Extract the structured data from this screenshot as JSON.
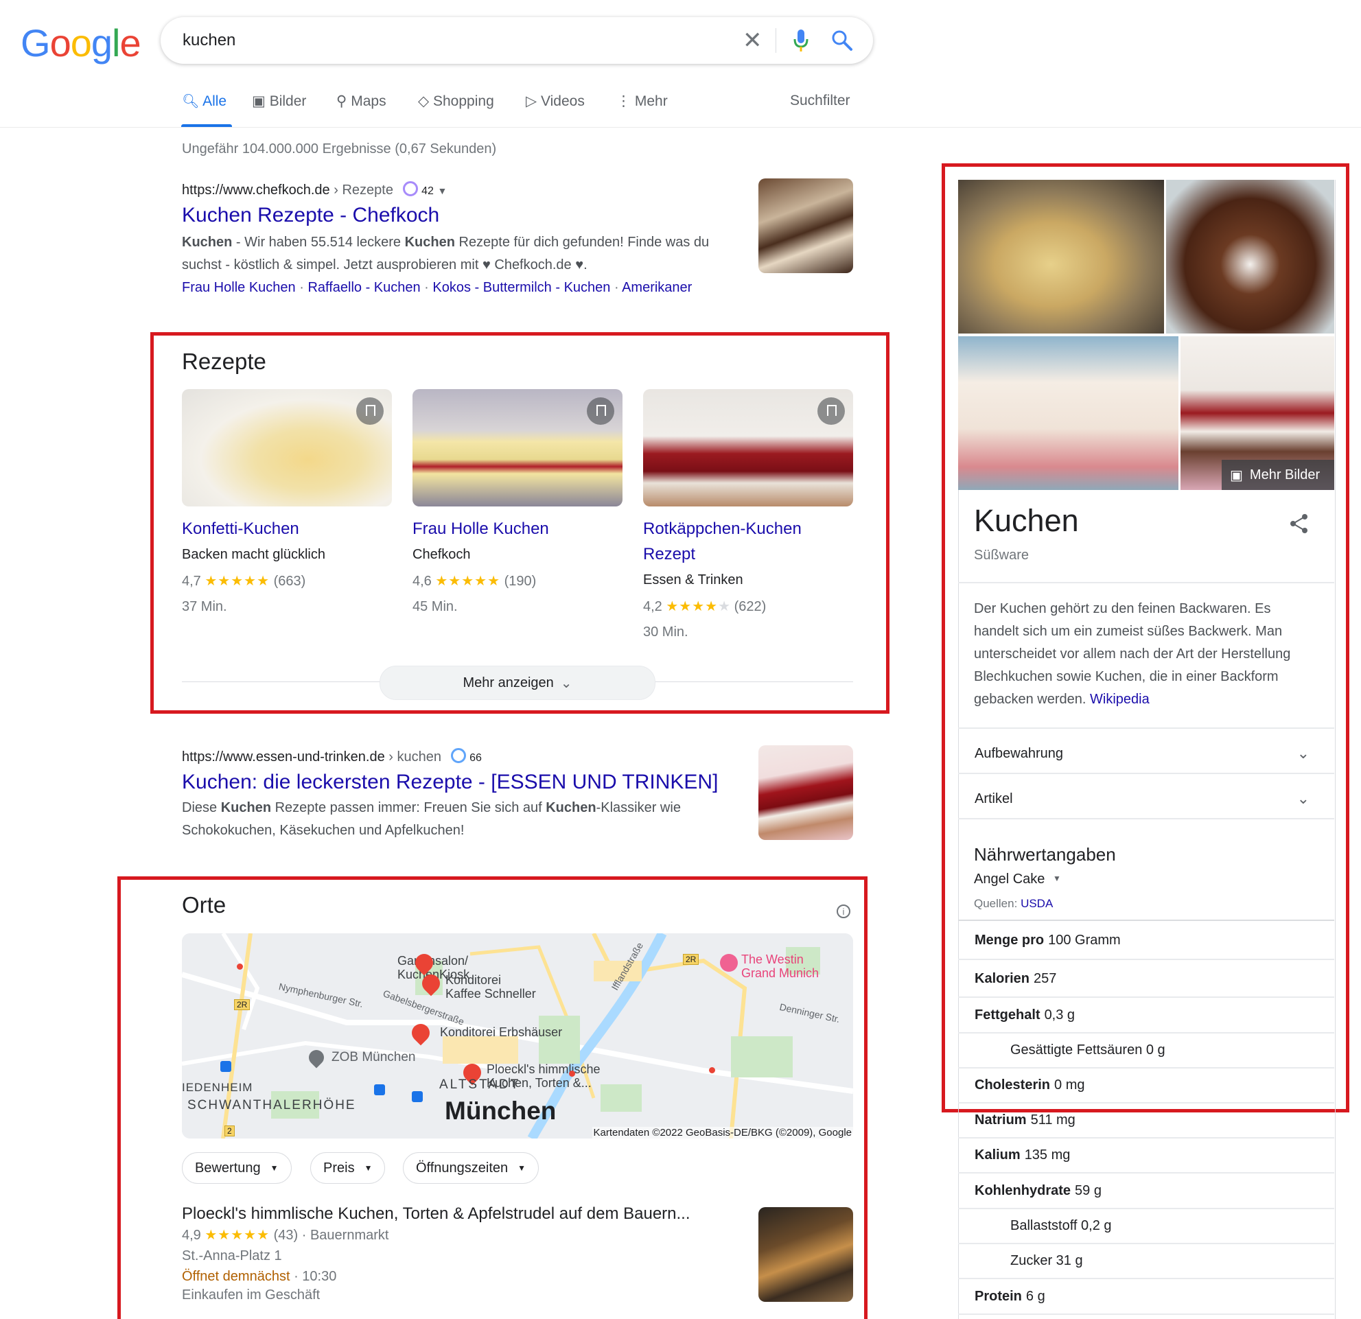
{
  "header": {
    "logo_text": "Google",
    "query": "kuchen",
    "clear_icon": "close-icon",
    "voice_icon": "microphone-icon",
    "search_icon": "search-icon"
  },
  "nav": {
    "tabs": [
      {
        "label": "Alle",
        "icon": "search-icon",
        "active": true
      },
      {
        "label": "Bilder",
        "icon": "image-icon"
      },
      {
        "label": "Maps",
        "icon": "location-pin-icon"
      },
      {
        "label": "Shopping",
        "icon": "tag-icon"
      },
      {
        "label": "Videos",
        "icon": "play-icon"
      },
      {
        "label": "Mehr",
        "icon": "more-vert-icon"
      }
    ],
    "tools": "Suchfilter"
  },
  "stats": "Ungefähr 104.000.000 Ergebnisse (0,67 Sekunden)",
  "result1": {
    "url": "https://www.chefkoch.de",
    "path": "› Rezepte",
    "score": "42",
    "title": "Kuchen Rezepte - Chefkoch",
    "snippet_b1": "Kuchen",
    "snippet_1": " - Wir haben 55.514 leckere ",
    "snippet_b2": "Kuchen",
    "snippet_2": " Rezepte für dich gefunden! Finde was du",
    "snippet_3": "suchst - köstlich & simpel. Jetzt ausprobieren mit ♥ Chefkoch.de ♥.",
    "sitelinks": [
      "Frau Holle Kuchen",
      "Raffaello - Kuchen",
      "Kokos - Buttermilch - Kuchen",
      "Amerikaner"
    ]
  },
  "recipes": {
    "heading": "Rezepte",
    "cards": [
      {
        "title": "Konfetti-Kuchen",
        "title2": "",
        "source": "Backen macht glücklich",
        "rating": "4,7",
        "stars": "★★★★★",
        "count": "(663)",
        "time": "37 Min."
      },
      {
        "title": "Frau Holle Kuchen",
        "title2": "",
        "source": "Chefkoch",
        "rating": "4,6",
        "stars": "★★★★★",
        "count": "(190)",
        "time": "45 Min."
      },
      {
        "title": "Rotkäppchen-Kuchen",
        "title2": "Rezept",
        "source": "Essen & Trinken",
        "rating": "4,2",
        "stars": "★★★★",
        "stars_empty": "★",
        "count": "(622)",
        "time": "30 Min."
      }
    ],
    "more": "Mehr anzeigen"
  },
  "result2": {
    "url": "https://www.essen-und-trinken.de",
    "path": "› kuchen",
    "score": "66",
    "title": "Kuchen: die leckersten Rezepte - [ESSEN UND TRINKEN]",
    "snippet_1": "Diese ",
    "snippet_b1": "Kuchen",
    "snippet_2": " Rezepte passen immer: Freuen Sie sich auf ",
    "snippet_b2": "Kuchen",
    "snippet_3": "-Klassiker wie",
    "snippet_4": "Schokokuchen, Käsekuchen und Apfelkuchen!"
  },
  "places": {
    "heading": "Orte",
    "map_labels": {
      "p1": "Gartensalon/",
      "p1b": "KuchenKiosk",
      "p2": "Konditorei",
      "p2b": "Kaffee Schneller",
      "p3": "Konditorei Erbshäuser",
      "p4": "Ploeckl's himmlische",
      "p4b": "Kuchen, Torten &...",
      "p5": "The Westin",
      "p5b": "Grand Munich",
      "zob": "ZOB München",
      "altstadt": "ALTSTADT",
      "city": "München",
      "schwan": "SCHWANTHALERHÖHE",
      "lied": "IEDENHEIM",
      "nymph": "Nymphenburger Str.",
      "gabel": "Gabelsbergerstraße",
      "denn": "Denninger Str.",
      "iffl": "Ifflandstraße",
      "r2a": "2R",
      "r2b": "2R",
      "r2c": "2",
      "copyright": "Kartendaten ©2022 GeoBasis-DE/BKG (©2009), Google"
    },
    "filters": [
      "Bewertung",
      "Preis",
      "Öffnungszeiten"
    ],
    "listing": {
      "name": "Ploeckl's himmlische Kuchen, Torten & Apfelstrudel auf dem Bauern...",
      "rating": "4,9",
      "stars": "★★★★★",
      "count": "(43)",
      "area": "· Bauernmarkt",
      "address": "St.-Anna-Platz 1",
      "status": "Öffnet demnächst",
      "time": "· 10:30",
      "note": "Einkaufen im Geschäft"
    }
  },
  "knowledge": {
    "more_images": "Mehr Bilder",
    "title": "Kuchen",
    "subtitle": "Süßware",
    "description": "Der Kuchen gehört zu den feinen Backwaren. Es handelt sich um ein zumeist süßes Backwerk. Man unterscheidet vor allem nach der Art der Herstellung Blechkuchen sowie Kuchen, die in einer Backform gebacken werden.",
    "wiki": "Wikipedia",
    "expanders": [
      "Aufbewahrung",
      "Artikel"
    ],
    "nutrition_heading": "Nährwertangaben",
    "food": "Angel Cake",
    "sources_label": "Quellen:",
    "sources_link": "USDA",
    "rows": [
      {
        "label": "Menge pro",
        "value": "100 Gramm"
      },
      {
        "label": "Kalorien",
        "value": "257"
      },
      {
        "label": "Fettgehalt",
        "value": "0,3 g"
      },
      {
        "label": "",
        "value": "Gesättigte Fettsäuren 0 g"
      },
      {
        "label": "Cholesterin",
        "value": "0 mg"
      },
      {
        "label": "Natrium",
        "value": "511 mg"
      },
      {
        "label": "Kalium",
        "value": "135 mg"
      },
      {
        "label": "Kohlenhydrate",
        "value": "59 g"
      },
      {
        "label": "",
        "value": "Ballaststoff 0,2 g"
      },
      {
        "label": "",
        "value": "Zucker 31 g"
      },
      {
        "label": "Protein",
        "value": "6 g"
      }
    ]
  },
  "colors": {
    "link": "#1a0dab",
    "accent": "#1a73e8",
    "highlight_box": "#d7191f",
    "star": "#fbbc04"
  }
}
